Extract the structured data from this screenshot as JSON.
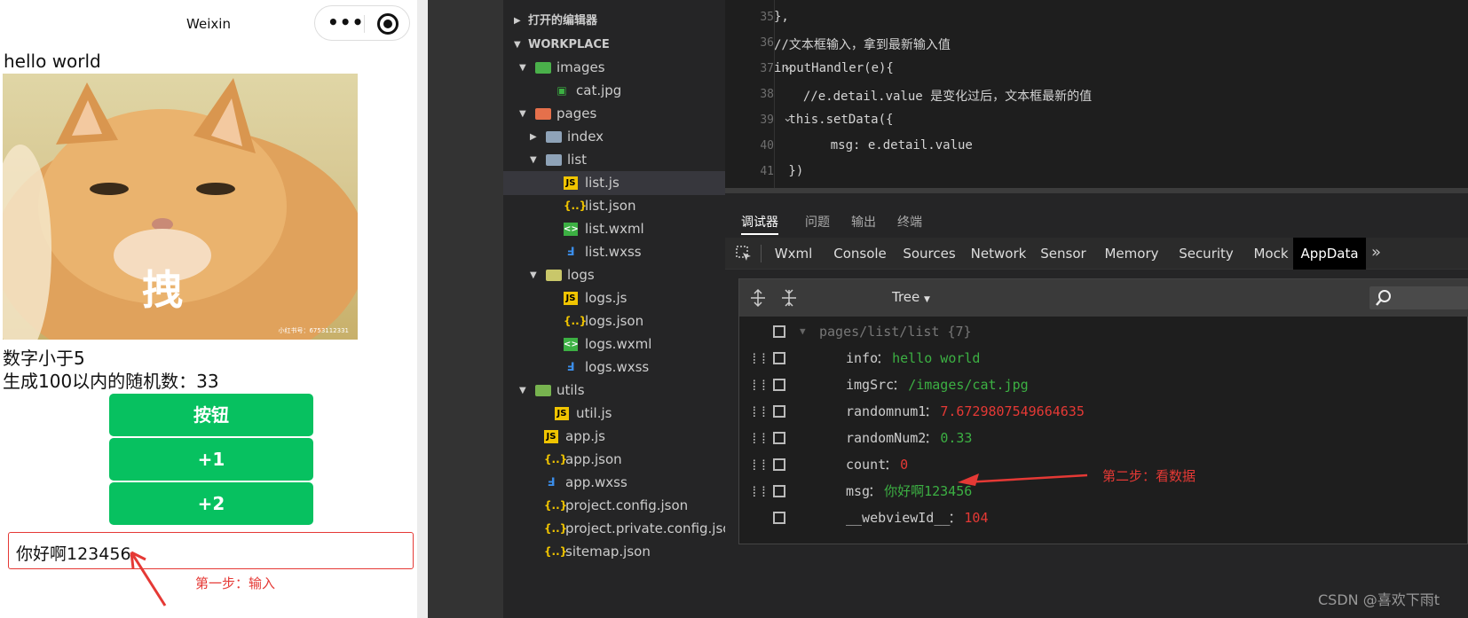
{
  "phone": {
    "nav_title": "Weixin",
    "hello": "hello world",
    "cat_caption": "拽",
    "cat_watermark": "小红书号：6753112331",
    "line1": "数字小于5",
    "line2": "生成100以内的随机数：33",
    "buttons": [
      "按钮",
      "+1",
      "+2"
    ],
    "input_value": "你好啊123456",
    "step1": "第一步：输入"
  },
  "explorer": {
    "sections": [
      "打开的编辑器",
      "WORKPLACE"
    ],
    "items": [
      {
        "label": "images",
        "type": "folder-img",
        "open": true
      },
      {
        "label": "cat.jpg",
        "type": "img"
      },
      {
        "label": "pages",
        "type": "folder-pages",
        "open": true
      },
      {
        "label": "index",
        "type": "folder",
        "open": false
      },
      {
        "label": "list",
        "type": "folder",
        "open": true
      },
      {
        "label": "list.js",
        "type": "js",
        "selected": true
      },
      {
        "label": "list.json",
        "type": "json"
      },
      {
        "label": "list.wxml",
        "type": "wxml"
      },
      {
        "label": "list.wxss",
        "type": "wxss"
      },
      {
        "label": "logs",
        "type": "folder-logs",
        "open": true
      },
      {
        "label": "logs.js",
        "type": "js"
      },
      {
        "label": "logs.json",
        "type": "json"
      },
      {
        "label": "logs.wxml",
        "type": "wxml"
      },
      {
        "label": "logs.wxss",
        "type": "wxss"
      },
      {
        "label": "utils",
        "type": "folder-utils",
        "open": true
      },
      {
        "label": "util.js",
        "type": "js"
      },
      {
        "label": "app.js",
        "type": "js"
      },
      {
        "label": "app.json",
        "type": "json"
      },
      {
        "label": "app.wxss",
        "type": "wxss"
      },
      {
        "label": "project.config.json",
        "type": "json"
      },
      {
        "label": "project.private.config.json",
        "type": "json"
      },
      {
        "label": "sitemap.json",
        "type": "json"
      }
    ]
  },
  "editor": {
    "lines": [
      {
        "n": "35",
        "code": "},"
      },
      {
        "n": "36",
        "code": "//文本框输入，拿到最新输入值"
      },
      {
        "n": "37",
        "code": "inputHandler(e){"
      },
      {
        "n": "38",
        "code": "  //e.detail.value 是变化过后，文本框最新的值"
      },
      {
        "n": "39",
        "code": " this.setData({"
      },
      {
        "n": "40",
        "code": "    msg: e.detail.value"
      },
      {
        "n": "41",
        "code": " })"
      }
    ]
  },
  "debugger": {
    "panel_tabs": [
      "调试器",
      "问题",
      "输出",
      "终端"
    ],
    "dev_tabs": [
      "Wxml",
      "Console",
      "Sources",
      "Network",
      "Sensor",
      "Memory",
      "Security",
      "Mock",
      "AppData"
    ],
    "active_tab": "AppData",
    "view_mode": "Tree",
    "root": "pages/list/list {7}",
    "rows": [
      {
        "key": "info",
        "value": "hello world",
        "color": "#3cb043"
      },
      {
        "key": "imgSrc",
        "value": "/images/cat.jpg",
        "color": "#3cb043"
      },
      {
        "key": "randomnum1",
        "value": "7.6729807549664635",
        "color": "#e53935"
      },
      {
        "key": "randomNum2",
        "value": "0.33",
        "color": "#3cb043"
      },
      {
        "key": "count",
        "value": "0",
        "color": "#e53935"
      },
      {
        "key": "msg",
        "value": "你好啊123456",
        "color": "#3cb043"
      },
      {
        "key": "__webviewId__",
        "value": "104",
        "color": "#e53935"
      }
    ],
    "step2": "第二步：看数据"
  },
  "watermark": "CSDN @喜欢下雨t",
  "colors": {
    "wechat_green": "#07c160",
    "annotation_red": "#e53935"
  }
}
